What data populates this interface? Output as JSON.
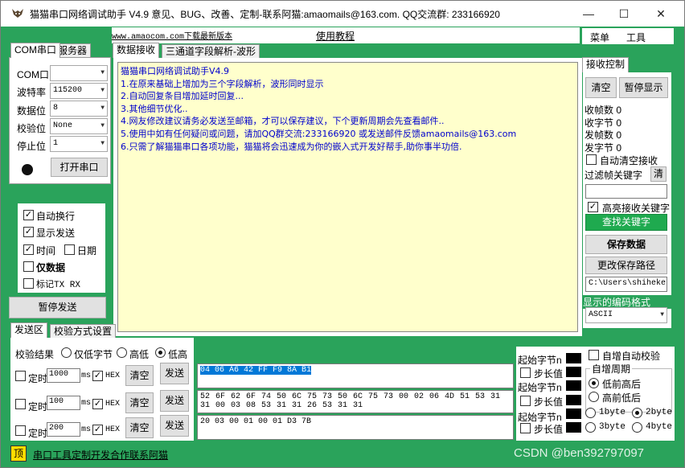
{
  "window": {
    "title": "猫猫串口网络调试助手 V4.9 意见、BUG、改善、定制-联系阿猫:amaomails@163.com. QQ交流群: 233166920",
    "minimize_glyph": "—",
    "maximize_glyph": "☐",
    "close_glyph": "✕"
  },
  "links": {
    "download": "www.amaocom.com下载最新版本",
    "tutorial": "使用教程"
  },
  "menu": {
    "menu_label": "菜单",
    "tools_label": "工具"
  },
  "com_panel": {
    "tab_com": "COM串口",
    "tab_server": "服务器",
    "com_label": "COM口",
    "com_value": "",
    "baud_label": "波特率",
    "baud_value": "115200",
    "databits_label": "数据位",
    "databits_value": "8",
    "parity_label": "校验位",
    "parity_value": "None",
    "stopbits_label": "停止位",
    "stopbits_value": "1",
    "open_button": "打开串口"
  },
  "options": {
    "auto_wrap": "自动换行",
    "show_send": "显示发送",
    "time": "时间",
    "date": "日期",
    "data_only": "仅数据",
    "mark_txrx": "标记TX RX"
  },
  "pause_send_button": "暂停发送",
  "recv_tabs": {
    "data_recv": "数据接收",
    "three_channel": "三通道字段解析-波形"
  },
  "recv_lines": [
    "猫猫串口网络调试助手V4.9",
    "1.在原来基础上增加为三个字段解析，波形同时显示",
    "2.自动回复条目增加延时回复...",
    "3.其他细节优化..",
    "4.网友修改建议请务必发送至邮箱，才可以保存建议，下个更新周期会先查看邮件..",
    "5.使用中如有任何疑问或问题，请加QQ群交流:233166920 或发送邮件反馈amaomails@163.com",
    "6.只需了解猫猫串口各项功能，猫猫将会迅速成为你的嵌入式开发好帮手,助你事半功倍."
  ],
  "recv_control": {
    "title": "接收控制",
    "clear_button": "清空",
    "pause_display_button": "暂停显示",
    "recv_frames": "收帧数 0",
    "recv_bytes": "收字节 0",
    "send_frames": "发帧数 0",
    "send_bytes": "发字节 0",
    "auto_clear": "自动清空接收",
    "filter_label": "过滤帧关键字",
    "filter_clear": "清",
    "highlight_keyword": "高亮接收关键字",
    "find_keyword_button": "查找关键字",
    "save_data_button": "保存数据",
    "change_path_button": "更改保存路径",
    "path_value": "C:\\Users\\shiheke",
    "encoding_label": "显示的编码格式",
    "encoding_value": "ASCII"
  },
  "send_tabs": {
    "send_area": "发送区",
    "checksum_mode": "校验方式设置"
  },
  "checksum": {
    "label": "校验结果",
    "low_only": "仅低字节",
    "high": "高低",
    "low": "低高"
  },
  "send_rows": [
    {
      "timed": "定时",
      "interval": "1000",
      "unit": "ms",
      "hex": "HEX",
      "clear": "清空",
      "send": "发送",
      "content": "04 06 A6 42 FF F9 8A B1"
    },
    {
      "timed": "定时",
      "interval": "100",
      "unit": "ms",
      "hex": "HEX",
      "clear": "清空",
      "send": "发送",
      "content": "52 6F 62 6F 74 50 6C 75 73 50 6C 75 73 00 02 06 4D 51 53 31 31 00 03 08 53 31 31 26 53 31 31"
    },
    {
      "timed": "定时",
      "interval": "200",
      "unit": "ms",
      "hex": "HEX",
      "clear": "清空",
      "send": "发送",
      "content": "20 03 00 01 00 01 D3 7B"
    }
  ],
  "checksum_config": {
    "start_byte": "起始字节n",
    "step": "步长值",
    "auto_increment": "自增自动校验",
    "period_title": "自增周期",
    "low_first": "低前高后",
    "high_first": "高前低后",
    "byte1": "1byte",
    "byte2": "2byte",
    "byte3": "3byte",
    "byte4": "4byte"
  },
  "footer": {
    "top_badge": "顶",
    "link": "串口工具定制开发合作联系阿猫"
  },
  "watermark": "CSDN @ben392797097",
  "colors": {
    "frame_green": "#2aa35b",
    "recv_bg": "#ffffcc",
    "recv_text": "#0000cc",
    "find_button": "#1faa4f"
  }
}
